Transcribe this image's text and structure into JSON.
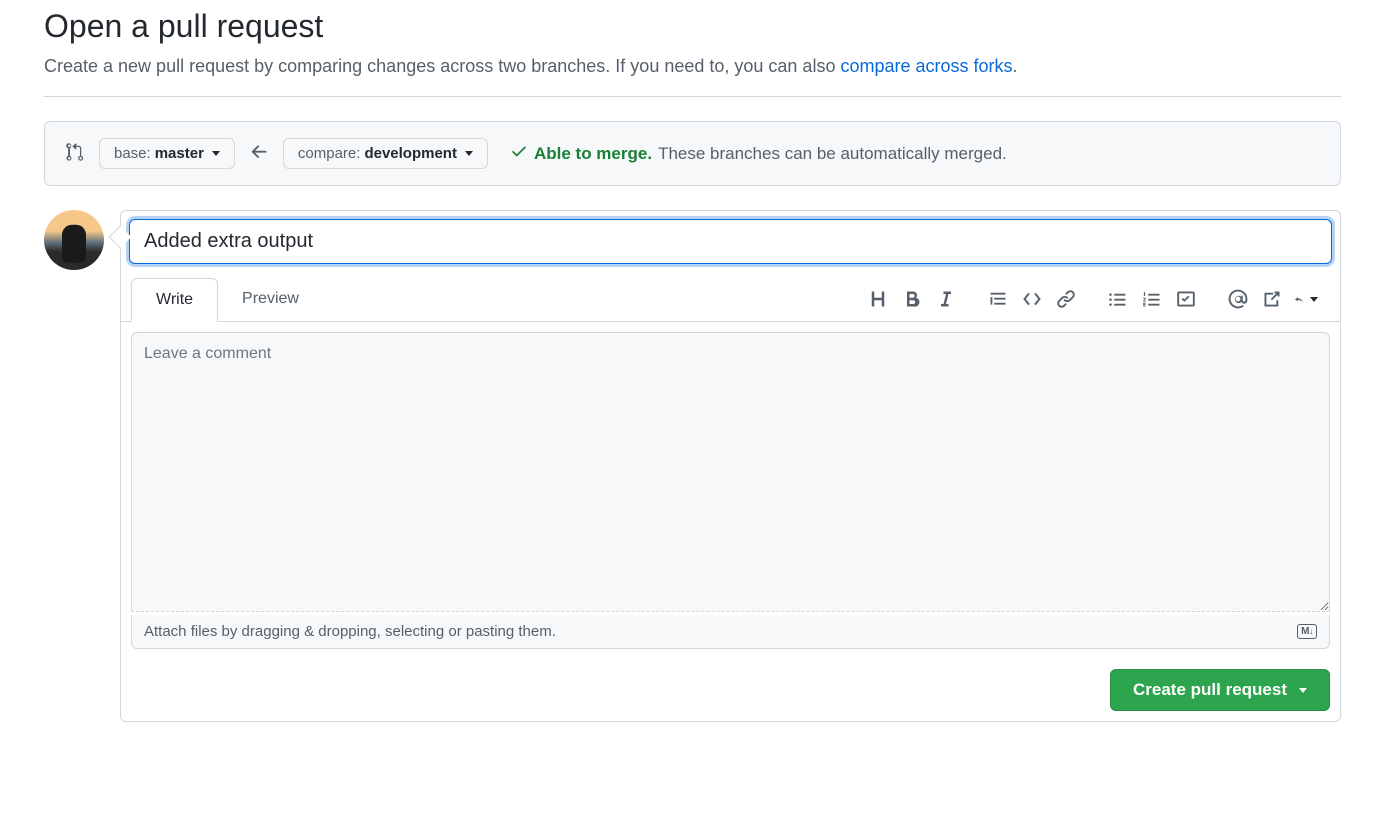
{
  "header": {
    "title": "Open a pull request",
    "subtitle_before_link": "Create a new pull request by comparing changes across two branches. If you need to, you can also ",
    "subtitle_link": "compare across forks",
    "subtitle_after_link": "."
  },
  "compare": {
    "base_label": "base: ",
    "base_branch": "master",
    "compare_label": "compare: ",
    "compare_branch": "development",
    "merge_status_strong": "Able to merge.",
    "merge_status_text": "These branches can be automatically merged."
  },
  "form": {
    "title_value": "Added extra output",
    "tabs": {
      "write": "Write",
      "preview": "Preview"
    },
    "comment_placeholder": "Leave a comment",
    "attach_hint": "Attach files by dragging & dropping, selecting or pasting them.",
    "markdown_badge": "M",
    "submit_label": "Create pull request"
  }
}
